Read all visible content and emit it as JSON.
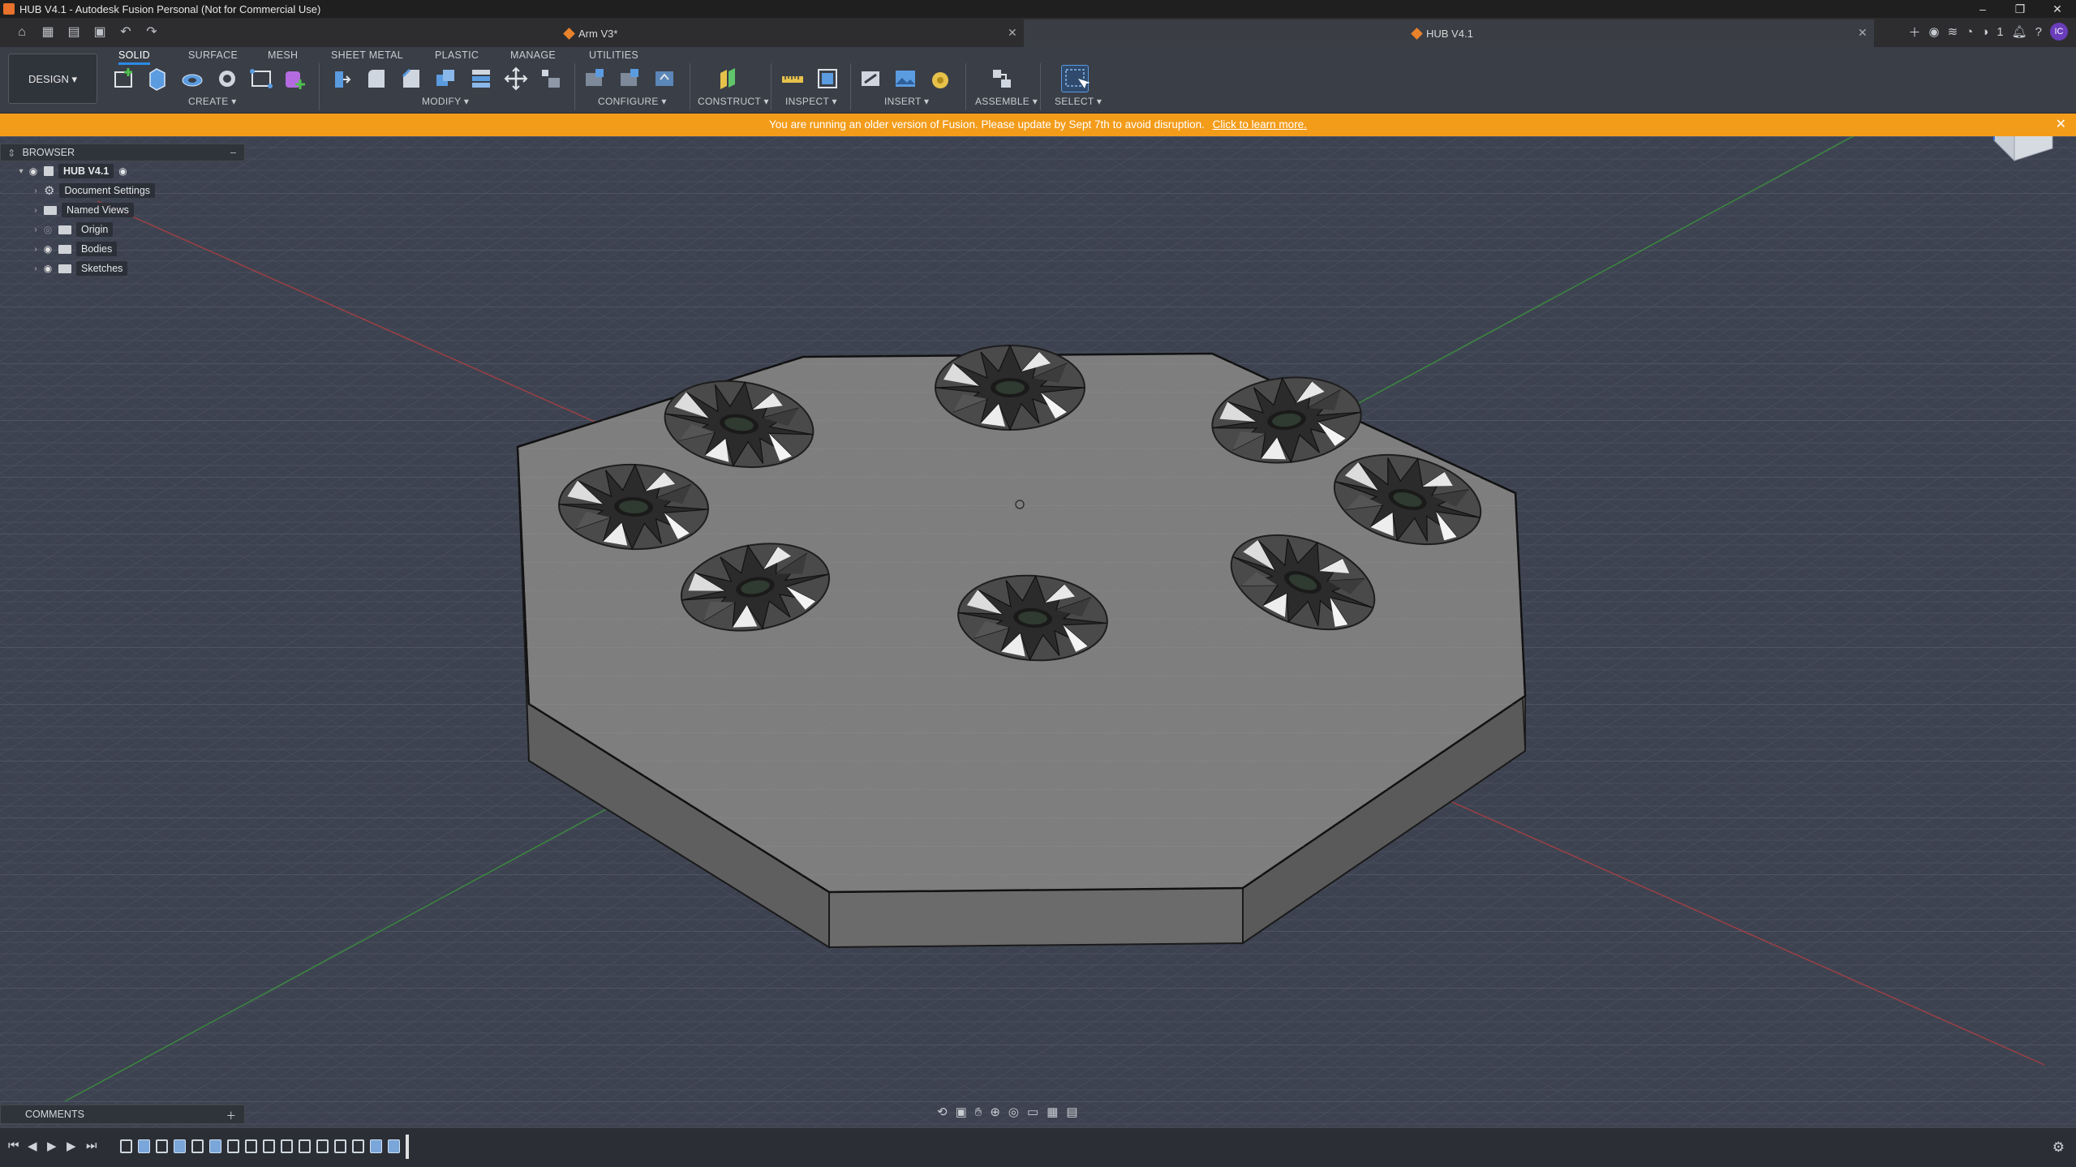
{
  "window": {
    "title": "HUB V4.1 - Autodesk Fusion Personal (Not for Commercial Use)",
    "controls": [
      "–",
      "❐",
      "✕"
    ]
  },
  "tabs": [
    {
      "label": "Arm V3*",
      "active": false
    },
    {
      "label": "HUB V4.1",
      "active": true
    }
  ],
  "top_right": {
    "job_count": "1",
    "user_initials": "IC"
  },
  "ribbon": {
    "workspace": "DESIGN ▾",
    "tabs": [
      "SOLID",
      "SURFACE",
      "MESH",
      "SHEET METAL",
      "PLASTIC",
      "MANAGE",
      "UTILITIES"
    ],
    "groups": [
      "CREATE ▾",
      "MODIFY ▾",
      "CONFIGURE ▾",
      "CONSTRUCT ▾",
      "INSPECT ▾",
      "INSERT ▾",
      "ASSEMBLE ▾",
      "SELECT ▾"
    ]
  },
  "banner": {
    "text": "You are running an older version of Fusion. Please update by Sept 7th to avoid disruption.",
    "link": "Click to learn more."
  },
  "browser": {
    "title": "BROWSER",
    "root": "HUB V4.1",
    "items": [
      "Document Settings",
      "Named Views",
      "Origin",
      "Bodies",
      "Sketches"
    ]
  },
  "comments": {
    "title": "COMMENTS"
  },
  "colors": {
    "accent": "#2b8be6",
    "banner": "#f39c1a",
    "viewport_bg": "#3d4250",
    "plate_top": "#7e7e7e",
    "plate_side": "#666666"
  },
  "icons": [
    "home-icon",
    "grid-icon",
    "file-icon",
    "save-icon",
    "undo-icon",
    "redo-icon",
    "bell-icon",
    "help-icon",
    "gear-icon",
    "play-icon"
  ]
}
